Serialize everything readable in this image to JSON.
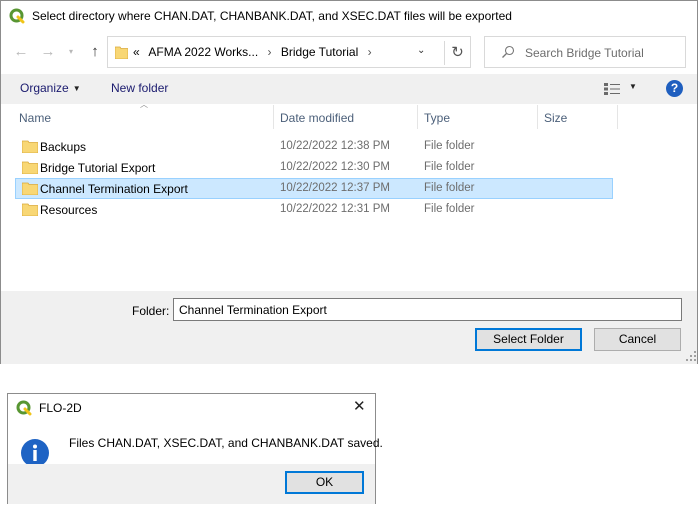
{
  "file_dialog": {
    "title": "Select directory where CHAN.DAT, CHANBANK.DAT, and XSEC.DAT files will be exported",
    "nav": {
      "back_icon": "arrow-left-icon",
      "forward_icon": "arrow-right-icon",
      "recent_icon": "chevron-down-icon",
      "up_icon": "arrow-up-icon"
    },
    "address": {
      "overflow": "«",
      "crumbs": [
        "AFMA 2022 Works...",
        "Bridge Tutorial"
      ],
      "separator": "›",
      "refresh_icon": "refresh-icon"
    },
    "search": {
      "placeholder": "Search Bridge Tutorial"
    },
    "toolbar": {
      "organize_label": "Organize",
      "new_folder_label": "New folder"
    },
    "columns": {
      "name": "Name",
      "date": "Date modified",
      "type": "Type",
      "size": "Size"
    },
    "files": [
      {
        "name": "Backups",
        "date": "10/22/2022 12:38 PM",
        "type": "File folder",
        "selected": false
      },
      {
        "name": "Bridge Tutorial Export",
        "date": "10/22/2022 12:30 PM",
        "type": "File folder",
        "selected": false
      },
      {
        "name": "Channel Termination Export",
        "date": "10/22/2022 12:37 PM",
        "type": "File folder",
        "selected": true
      },
      {
        "name": "Resources",
        "date": "10/22/2022 12:31 PM",
        "type": "File folder",
        "selected": false
      }
    ],
    "folder_label": "Folder:",
    "folder_value": "Channel Termination Export",
    "select_button": "Select Folder",
    "cancel_button": "Cancel"
  },
  "message_box": {
    "title": "FLO-2D",
    "close_glyph": "✕",
    "message": "Files CHAN.DAT, XSEC.DAT, and CHANBANK.DAT saved.",
    "ok_button": "OK"
  },
  "colors": {
    "accent": "#0078d7",
    "selection_bg": "#cce8ff",
    "selection_border": "#99d1ff",
    "qgis_green": "#589632",
    "qgis_yellow": "#f0c419",
    "folder_yellow": "#f8d775",
    "info_blue": "#1e63c4"
  }
}
